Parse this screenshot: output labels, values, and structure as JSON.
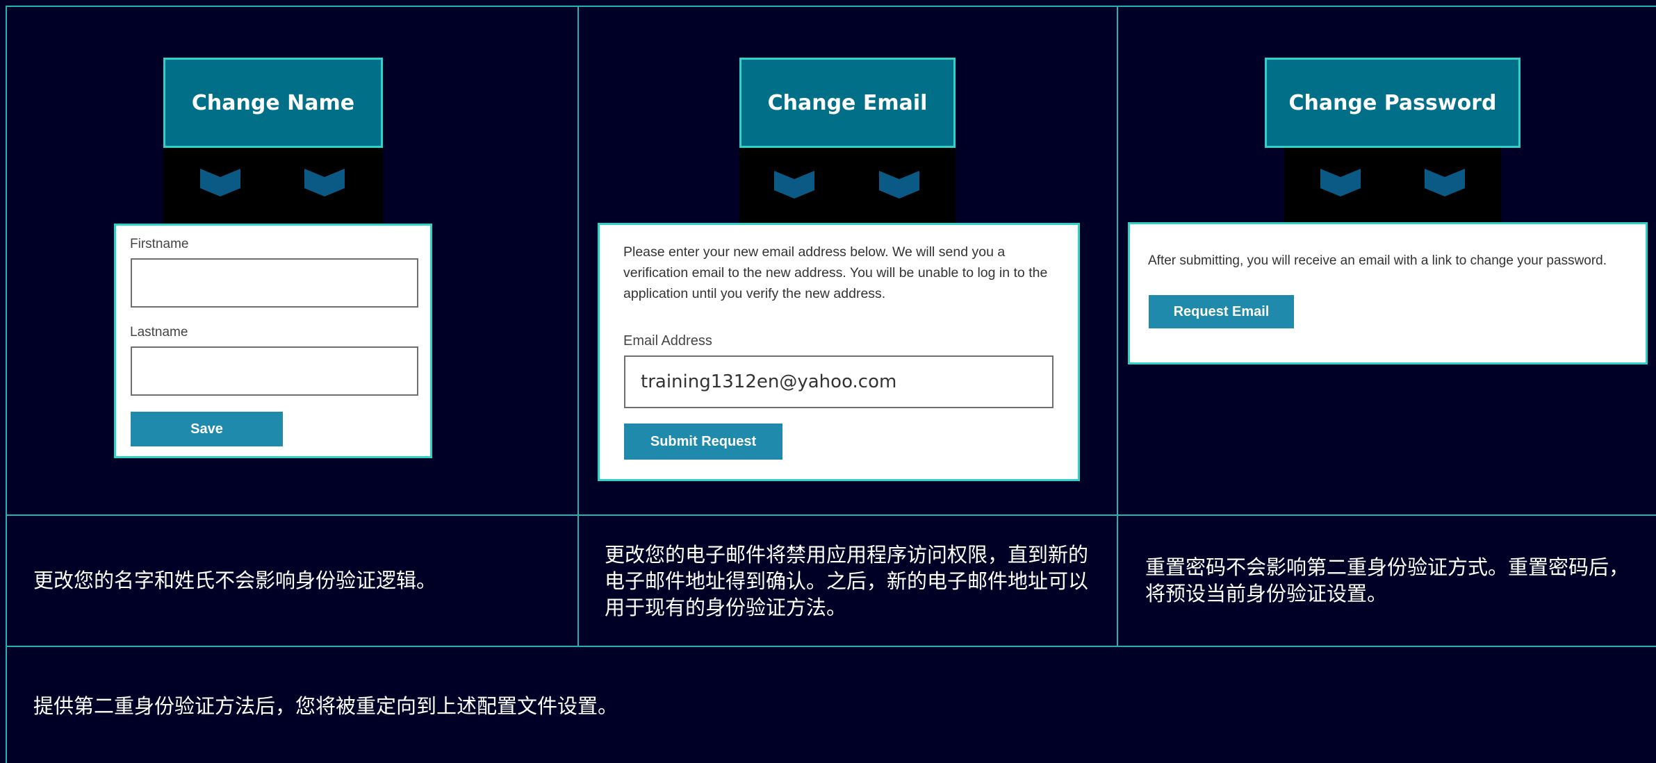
{
  "change_name": {
    "heading": "Change Name",
    "firstname_label": "Firstname",
    "firstname_value": "",
    "lastname_label": "Lastname",
    "lastname_value": "",
    "save_label": "Save"
  },
  "change_email": {
    "heading": "Change Email",
    "info": "Please enter your new email address below. We will send you a verification email to the new address. You will be unable to log in to the application until you verify the new address.",
    "email_label": "Email Address",
    "email_value": "training1312en@yahoo.com",
    "submit_label": "Submit Request"
  },
  "change_password": {
    "heading": "Change Password",
    "info": "After submitting, you will receive an email with a link to change your password.",
    "request_label": "Request Email"
  },
  "notes": {
    "name": "更改您的名字和姓氏不会影响身份验证逻辑。",
    "email": "更改您的电子邮件将禁用应用程序访问权限，直到新的电子邮件地址得到确认。之后，新的电子邮件地址可以用于现有的身份验证方法。",
    "password": "重置密码不会影响第二重身份验证方式。重置密码后，将预设当前身份验证设置。",
    "footer": "提供第二重身份验证方法后，您将被重定向到上述配置文件设置。"
  },
  "colors": {
    "background": "#000026",
    "grid": "#1fb3b3",
    "heading_fill": "#006f87",
    "accent_border": "#2fd2c6",
    "button": "#1f8aab",
    "chevron": "#0a5a85"
  }
}
